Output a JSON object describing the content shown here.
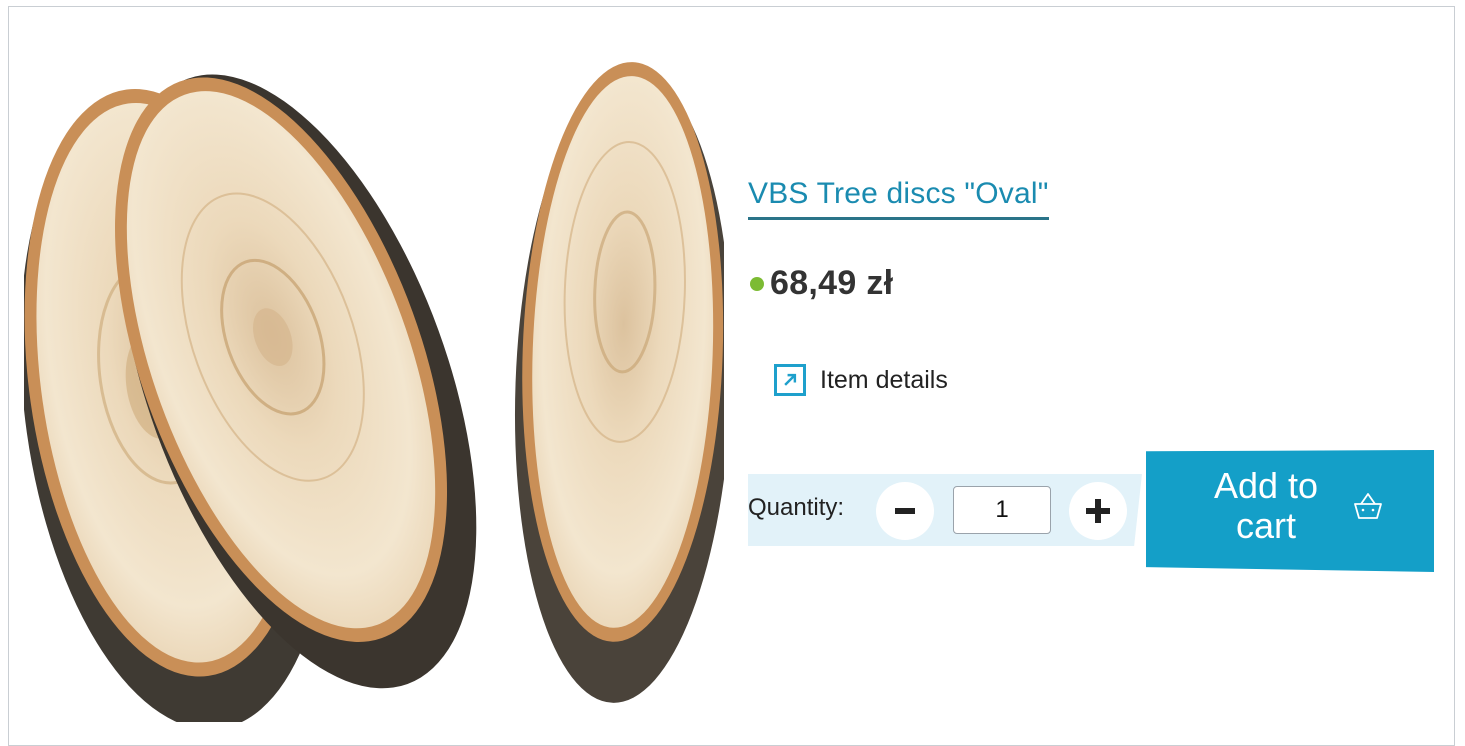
{
  "product": {
    "title": "VBS Tree discs \"Oval\"",
    "price": "68,49 zł",
    "availability_color": "#7cbb33",
    "image_alt": "VBS Tree discs Oval"
  },
  "details": {
    "label": "Item details",
    "icon": "external-arrow-icon"
  },
  "quantity": {
    "label": "Quantity:",
    "value": "1",
    "decrease_icon": "minus-icon",
    "increase_icon": "plus-icon"
  },
  "cart": {
    "label": "Add to cart",
    "icon": "basket-icon"
  },
  "colors": {
    "accent": "#149fc8",
    "link": "#1a8bb0",
    "band": "#e2f2f9"
  }
}
